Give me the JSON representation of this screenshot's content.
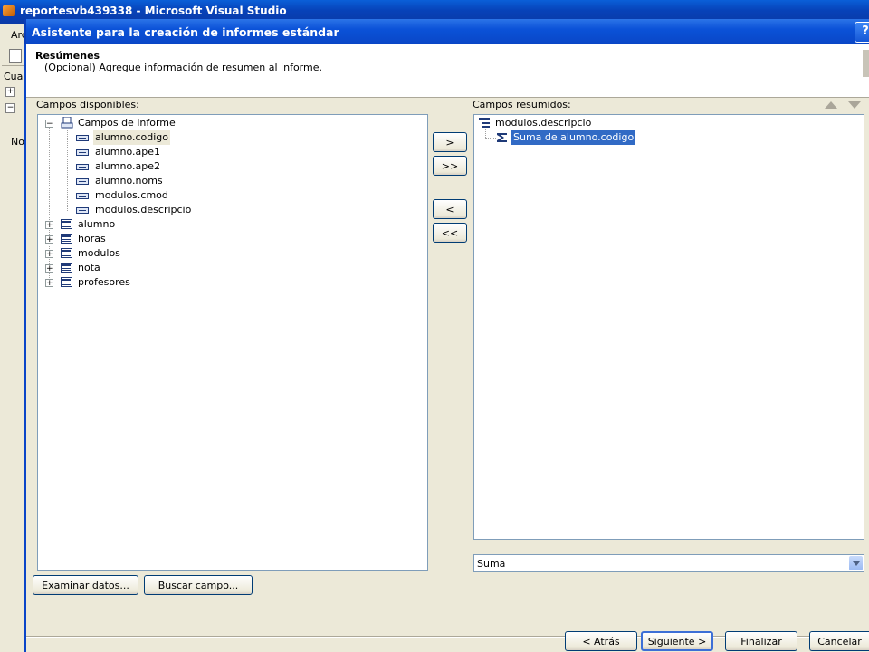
{
  "vs": {
    "title": "reportesvb439338 - Microsoft Visual Studio",
    "menu_fragment": "Arc",
    "panel_fragment": "Cuad",
    "no_fragment": "No"
  },
  "dialog": {
    "title": "Asistente para la creación de informes estándar",
    "help": "?",
    "heading": "Resúmenes",
    "subheading": "(Opcional) Agregue información de resumen al informe."
  },
  "available": {
    "label": "Campos disponibles:",
    "root": "Campos de informe",
    "fields": [
      "alumno.codigo",
      "alumno.ape1",
      "alumno.ape2",
      "alumno.noms",
      "modulos.cmod",
      "modulos.descripcio"
    ],
    "tables": [
      "alumno",
      "horas",
      "modulos",
      "nota",
      "profesores"
    ]
  },
  "summarized": {
    "label": "Campos resumidos:",
    "group": "modulos.descripcio",
    "summary": "Suma de alumno.codigo",
    "function": "Suma"
  },
  "buttons": {
    "add": ">",
    "add_all": ">>",
    "remove": "<",
    "remove_all": "<<",
    "browse": "Examinar datos...",
    "find": "Buscar campo...",
    "back": "< Atrás",
    "next": "Siguiente >",
    "finish": "Finalizar",
    "cancel": "Cancelar"
  }
}
